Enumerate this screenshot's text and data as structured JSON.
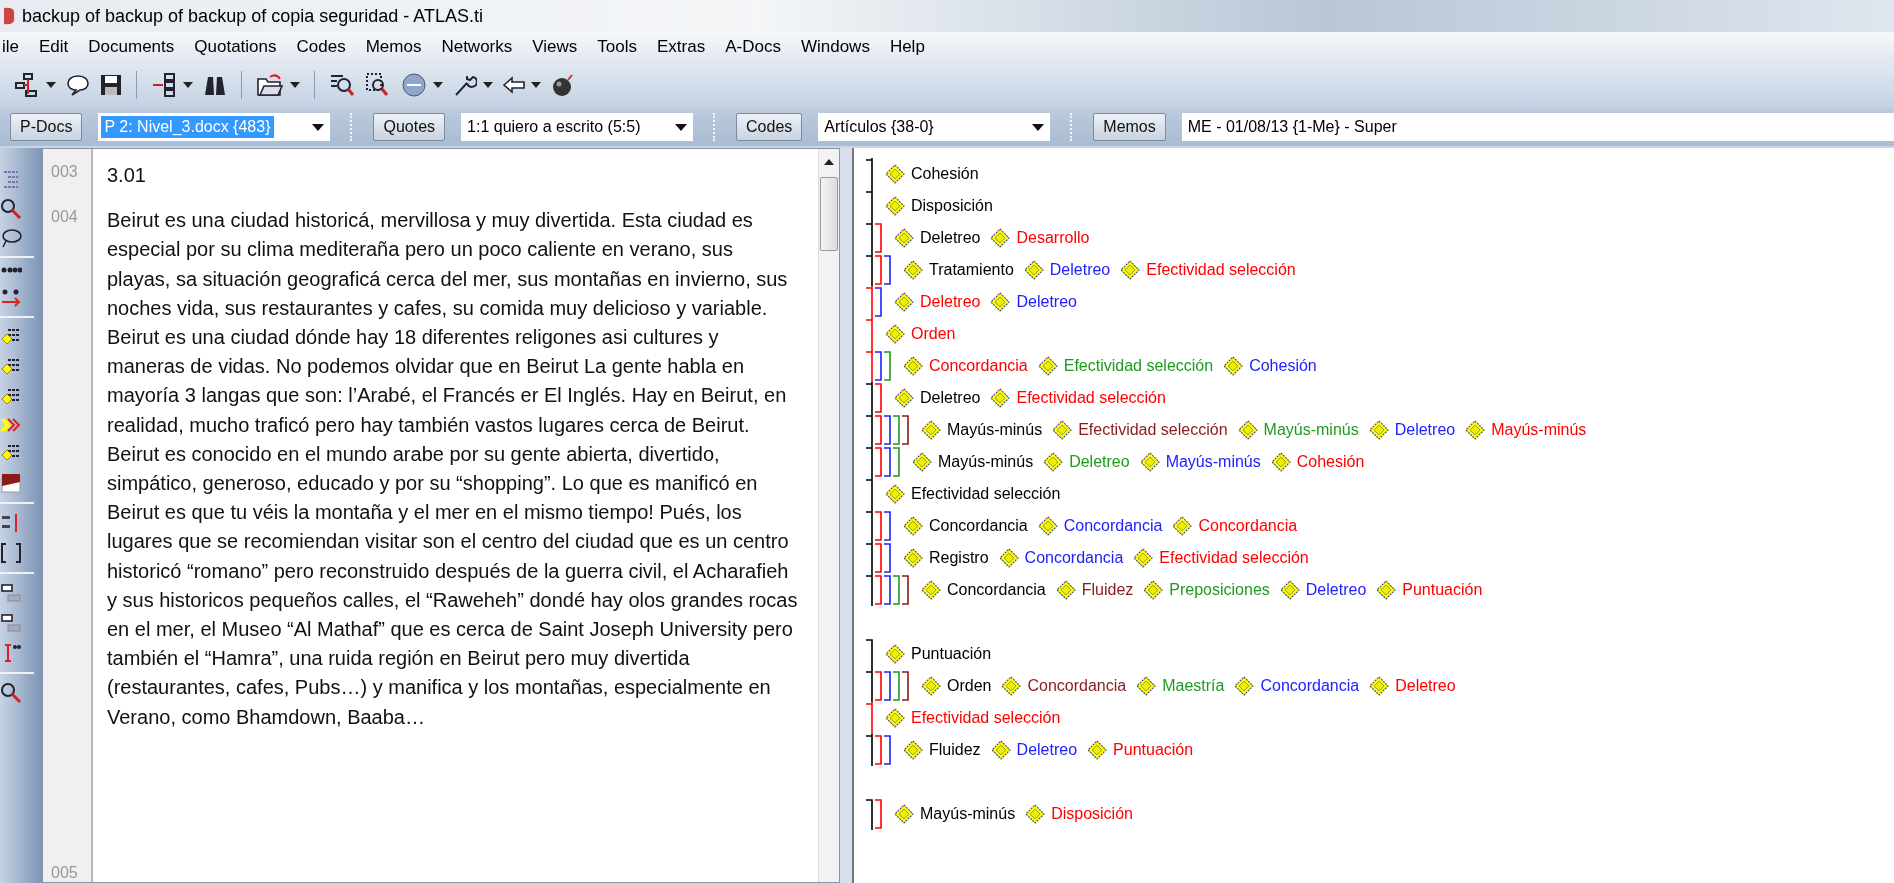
{
  "window": {
    "title": "backup of backup of backup of copia seguridad - ATLAS.ti"
  },
  "menu": [
    "ile",
    "Edit",
    "Documents",
    "Quotations",
    "Codes",
    "Memos",
    "Networks",
    "Views",
    "Tools",
    "Extras",
    "A-Docs",
    "Windows",
    "Help"
  ],
  "selectors": [
    {
      "button": "P-Docs",
      "value": "P 2: Nivel_3.docx {483}",
      "highlighted": true,
      "dropdown": true
    },
    {
      "button": "Quotes",
      "value": "1:1 quiero a escrito (5:5)",
      "highlighted": false,
      "dropdown": true
    },
    {
      "button": "Codes",
      "value": "Artículos {38-0}",
      "highlighted": false,
      "dropdown": true
    },
    {
      "button": "Memos",
      "value": "ME - 01/08/13 {1-Me} - Super",
      "highlighted": false,
      "dropdown": false
    }
  ],
  "document": {
    "lines": [
      {
        "number": "003",
        "text": "3.01"
      },
      {
        "number": "004",
        "text": "Beirut es una ciudad historicá, mervillosa y muy divertida. Esta ciudad es especial por su clima mediteraña pero un poco caliente en verano, sus playas, sa situación geograficá cerca del mer, sus montañas en invierno, sus noches vida, sus restaurantes y cafes, su comida muy delicioso y variable. Beirut es una ciudad dónde hay 18 diferentes religones asi cultures y maneras de vidas. No podemos olvidar que en Beirut La gente habla en mayoría 3 langas que son: l’Arabé, el Francés er El Inglés. Hay en Beirut, en realidad, mucho traficó pero hay también vastos lugares cerca de Beirut. Beirut es conocido en el mundo arabe por su gente abierta, divertido, simpático, generoso, educado y por su “shopping”. Lo que es manificó en Beirut es que tu véis la montaña y el mer en el mismo tiempo! Pués, los lugares que se recomiendan visitar son el centro del ciudad que es un centro historicó “romano” pero reconstruido después de la guerra civil, el Acharafieh y sus historicos pequeños calles, el “Raweheh” dondé hay olos grandes rocas en el mer, el Museo “Al Mathaf” que es cerca de Saint Joseph University pero también el “Hamra”, una ruida región en Beirut pero muy divertida (restaurantes, cafes, Pubs…) y manifica y los montañas, especialmente en Verano, como Bhamdown, Baaba…"
      },
      {
        "number": "005"
      }
    ]
  },
  "margin": {
    "rows": [
      {
        "gap_before": false,
        "codes": [
          {
            "label": "Cohesión",
            "color": "#000000"
          }
        ]
      },
      {
        "gap_before": false,
        "codes": [
          {
            "label": "Disposición",
            "color": "#000000"
          }
        ]
      },
      {
        "gap_before": false,
        "codes": [
          {
            "label": "Deletreo",
            "color": "#000000"
          },
          {
            "label": "Desarrollo",
            "color": "#ff0000"
          }
        ]
      },
      {
        "gap_before": false,
        "codes": [
          {
            "label": "Tratamiento",
            "color": "#000000"
          },
          {
            "label": "Deletreo",
            "color": "#2020ff"
          },
          {
            "label": "Efectividad selección",
            "color": "#ff0000"
          }
        ]
      },
      {
        "gap_before": false,
        "codes": [
          {
            "label": "Deletreo",
            "color": "#ff0000"
          },
          {
            "label": "Deletreo",
            "color": "#2020ff"
          }
        ]
      },
      {
        "gap_before": false,
        "codes": [
          {
            "label": "Orden",
            "color": "#ff0000"
          }
        ]
      },
      {
        "gap_before": false,
        "codes": [
          {
            "label": "Concordancia",
            "color": "#ff0000"
          },
          {
            "label": "Efectividad selección",
            "color": "#1e9a1e"
          },
          {
            "label": "Cohesión",
            "color": "#2020ff"
          }
        ]
      },
      {
        "gap_before": false,
        "codes": [
          {
            "label": "Deletreo",
            "color": "#000000"
          },
          {
            "label": "Efectividad selección",
            "color": "#ff0000"
          }
        ]
      },
      {
        "gap_before": false,
        "codes": [
          {
            "label": "Mayús-minús",
            "color": "#000000"
          },
          {
            "label": "Efectividad selección",
            "color": "#8b1a1a"
          },
          {
            "label": "Mayús-minús",
            "color": "#1e9a1e"
          },
          {
            "label": "Deletreo",
            "color": "#2020ff"
          },
          {
            "label": "Mayús-minús",
            "color": "#ff0000"
          }
        ]
      },
      {
        "gap_before": false,
        "codes": [
          {
            "label": "Mayús-minús",
            "color": "#000000"
          },
          {
            "label": "Deletreo",
            "color": "#1e9a1e"
          },
          {
            "label": "Mayús-minús",
            "color": "#2020ff"
          },
          {
            "label": "Cohesión",
            "color": "#ff0000"
          }
        ]
      },
      {
        "gap_before": false,
        "codes": [
          {
            "label": "Efectividad selección",
            "color": "#000000"
          }
        ]
      },
      {
        "gap_before": false,
        "codes": [
          {
            "label": "Concordancia",
            "color": "#000000"
          },
          {
            "label": "Concordancia",
            "color": "#2020ff"
          },
          {
            "label": "Concordancia",
            "color": "#ff0000"
          }
        ]
      },
      {
        "gap_before": false,
        "codes": [
          {
            "label": "Registro",
            "color": "#000000"
          },
          {
            "label": "Concordancia",
            "color": "#2020ff"
          },
          {
            "label": "Efectividad selección",
            "color": "#ff0000"
          }
        ]
      },
      {
        "gap_before": false,
        "codes": [
          {
            "label": "Concordancia",
            "color": "#000000"
          },
          {
            "label": "Fluidez",
            "color": "#8b1a1a"
          },
          {
            "label": "Preposiciones",
            "color": "#1e9a1e"
          },
          {
            "label": "Deletreo",
            "color": "#2020ff"
          },
          {
            "label": "Puntuación",
            "color": "#ff0000"
          }
        ]
      },
      {
        "gap_before": true,
        "codes": [
          {
            "label": "Puntuación",
            "color": "#000000"
          }
        ]
      },
      {
        "gap_before": false,
        "codes": [
          {
            "label": "Orden",
            "color": "#000000"
          },
          {
            "label": "Concordancia",
            "color": "#8b1a1a"
          },
          {
            "label": "Maestría",
            "color": "#1e9a1e"
          },
          {
            "label": "Concordancia",
            "color": "#2020ff"
          },
          {
            "label": "Deletreo",
            "color": "#ff0000"
          }
        ]
      },
      {
        "gap_before": false,
        "codes": [
          {
            "label": "Efectividad selección",
            "color": "#ff0000"
          }
        ]
      },
      {
        "gap_before": false,
        "codes": [
          {
            "label": "Fluidez",
            "color": "#000000"
          },
          {
            "label": "Deletreo",
            "color": "#2020ff"
          },
          {
            "label": "Puntuación",
            "color": "#ff0000"
          }
        ]
      },
      {
        "gap_before": true,
        "codes": [
          {
            "label": "Mayús-minús",
            "color": "#000000"
          },
          {
            "label": "Disposición",
            "color": "#ff0000"
          }
        ]
      }
    ]
  }
}
